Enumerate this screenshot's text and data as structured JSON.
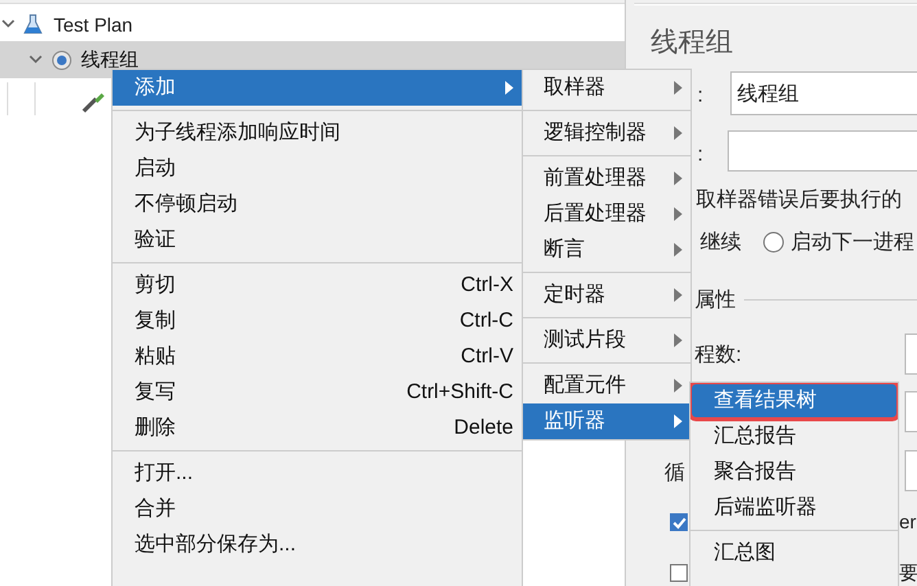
{
  "tree": [
    {
      "label": "Test Plan",
      "expanded": true,
      "selected": false,
      "children": [
        {
          "label": "线程组",
          "expanded": true,
          "selected": true
        }
      ]
    }
  ],
  "panel": {
    "title": "线程组",
    "name_label": ":",
    "name_value": "线程组",
    "comment_label": ":",
    "error_action_label": "取样器错误后要执行的",
    "radios": [
      {
        "label": "继续",
        "kind": "label_only"
      },
      {
        "label": "启动下一进程",
        "kind": "radio",
        "selected": false
      }
    ],
    "group_label": "属性",
    "threads_label": "程数:",
    "loop_label": "循",
    "checkboxes": [
      {
        "label": "er",
        "checked": true
      },
      {
        "label": "要",
        "checked": false
      }
    ]
  },
  "context_menu": [
    {
      "kind": "item",
      "label": "添加",
      "selected": true,
      "submenu": true
    },
    {
      "kind": "separator"
    },
    {
      "kind": "item",
      "label": "为子线程添加响应时间",
      "selected": false,
      "submenu": false
    },
    {
      "kind": "item",
      "label": "启动",
      "selected": false,
      "submenu": false
    },
    {
      "kind": "item",
      "label": "不停顿启动",
      "selected": false,
      "submenu": false
    },
    {
      "kind": "item",
      "label": "验证",
      "selected": false,
      "submenu": false
    },
    {
      "kind": "separator"
    },
    {
      "kind": "item",
      "label": "剪切",
      "shortcut": "Ctrl-X",
      "selected": false,
      "submenu": false
    },
    {
      "kind": "item",
      "label": "复制",
      "shortcut": "Ctrl-C",
      "selected": false,
      "submenu": false
    },
    {
      "kind": "item",
      "label": "粘贴",
      "shortcut": "Ctrl-V",
      "selected": false,
      "submenu": false
    },
    {
      "kind": "item",
      "label": "复写",
      "shortcut": "Ctrl+Shift-C",
      "selected": false,
      "submenu": false
    },
    {
      "kind": "item",
      "label": "删除",
      "shortcut": "Delete",
      "selected": false,
      "submenu": false
    },
    {
      "kind": "separator"
    },
    {
      "kind": "item",
      "label": "打开...",
      "selected": false,
      "submenu": false
    },
    {
      "kind": "item",
      "label": "合并",
      "selected": false,
      "submenu": false
    },
    {
      "kind": "item",
      "label": "选中部分保存为...",
      "selected": false,
      "submenu": false
    }
  ],
  "add_submenu": [
    {
      "kind": "item",
      "label": "取样器",
      "selected": false,
      "submenu": true
    },
    {
      "kind": "separator"
    },
    {
      "kind": "item",
      "label": "逻辑控制器",
      "selected": false,
      "submenu": true
    },
    {
      "kind": "separator"
    },
    {
      "kind": "item",
      "label": "前置处理器",
      "selected": false,
      "submenu": true
    },
    {
      "kind": "item",
      "label": "后置处理器",
      "selected": false,
      "submenu": true
    },
    {
      "kind": "item",
      "label": "断言",
      "selected": false,
      "submenu": true
    },
    {
      "kind": "separator"
    },
    {
      "kind": "item",
      "label": "定时器",
      "selected": false,
      "submenu": true
    },
    {
      "kind": "separator"
    },
    {
      "kind": "item",
      "label": "测试片段",
      "selected": false,
      "submenu": true
    },
    {
      "kind": "separator"
    },
    {
      "kind": "item",
      "label": "配置元件",
      "selected": false,
      "submenu": true
    },
    {
      "kind": "item",
      "label": "监听器",
      "selected": true,
      "submenu": true
    }
  ],
  "listener_submenu": [
    {
      "kind": "item",
      "label": "查看结果树",
      "selected": true,
      "outlined": true
    },
    {
      "kind": "item",
      "label": "汇总报告",
      "selected": false,
      "outlined": false
    },
    {
      "kind": "item",
      "label": "聚合报告",
      "selected": false,
      "outlined": false
    },
    {
      "kind": "item",
      "label": "后端监听器",
      "selected": false,
      "outlined": false
    },
    {
      "kind": "separator"
    },
    {
      "kind": "item",
      "label": "汇总图",
      "selected": false,
      "outlined": false
    }
  ]
}
